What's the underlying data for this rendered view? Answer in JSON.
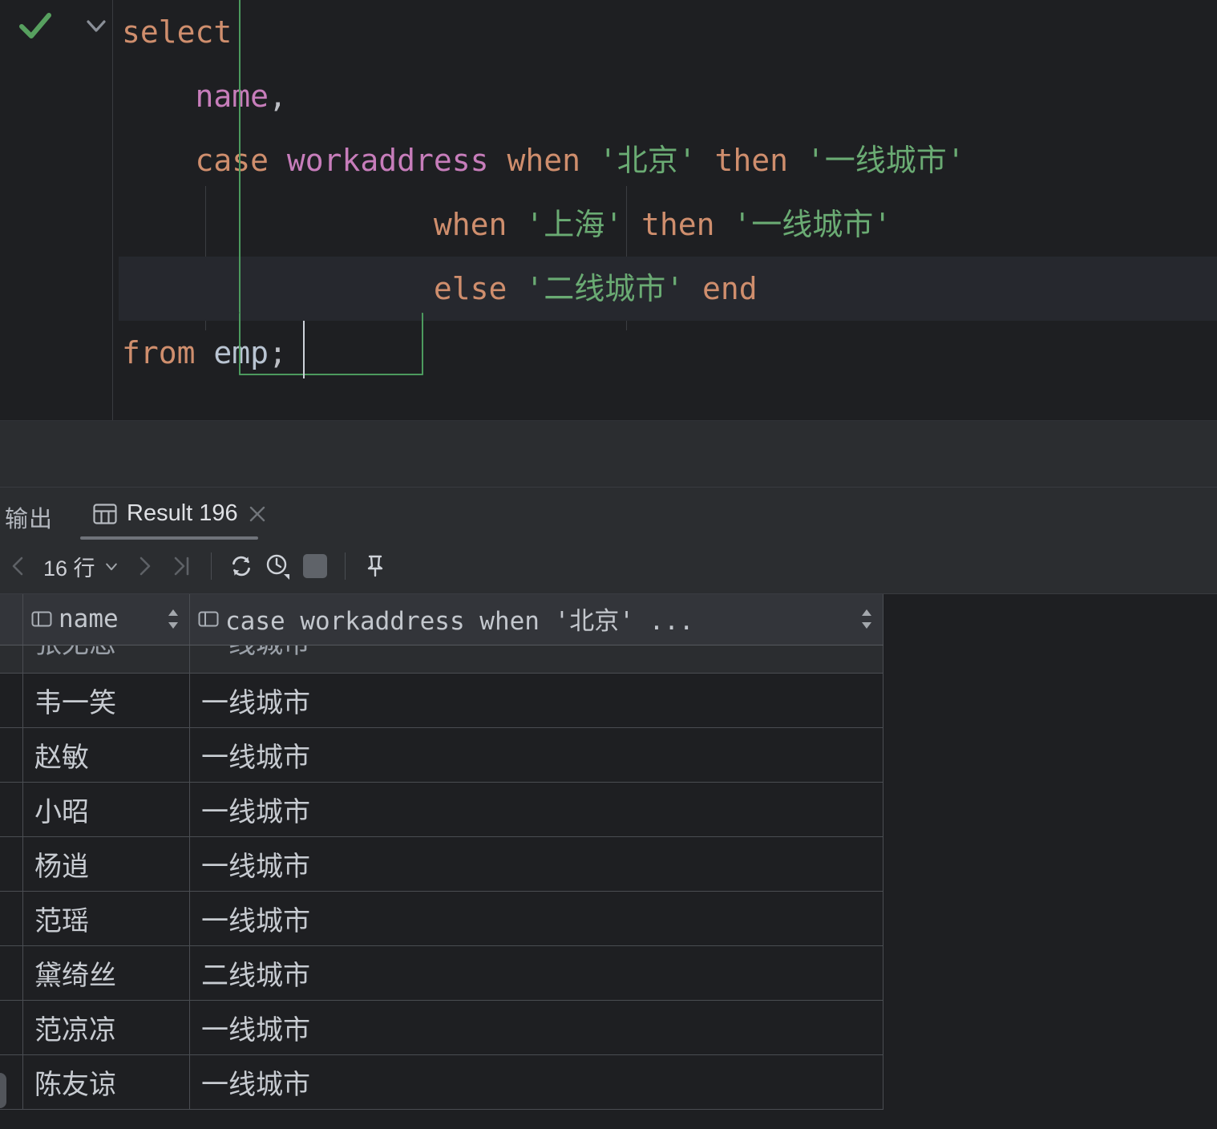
{
  "editor": {
    "status_icon": "green-check-ok",
    "fold_icon": "chevron-down",
    "lines": [
      {
        "id": "l1",
        "tokens": [
          {
            "t": "select",
            "c": "kw"
          }
        ]
      },
      {
        "id": "l2",
        "tokens": [
          {
            "t": "    name",
            "c": "col"
          },
          {
            "t": ",",
            "c": "plain"
          }
        ]
      },
      {
        "id": "l3",
        "tokens": [
          {
            "t": "    case ",
            "c": "kw"
          },
          {
            "t": "workaddress",
            "c": "col"
          },
          {
            "t": " when ",
            "c": "kw"
          },
          {
            "t": "'北京'",
            "c": "str"
          },
          {
            "t": " then ",
            "c": "kw"
          },
          {
            "t": "'一线城市'",
            "c": "str"
          }
        ]
      },
      {
        "id": "l4",
        "tokens": [
          {
            "t": "                 when ",
            "c": "kw"
          },
          {
            "t": "'上海'",
            "c": "str"
          },
          {
            "t": " then ",
            "c": "kw"
          },
          {
            "t": "'一线城市'",
            "c": "str"
          }
        ]
      },
      {
        "id": "l5",
        "tokens": [
          {
            "t": "                 else ",
            "c": "kw"
          },
          {
            "t": "'二线城市'",
            "c": "str"
          },
          {
            "t": " end",
            "c": "kw"
          }
        ]
      },
      {
        "id": "l6",
        "tokens": [
          {
            "t": "from ",
            "c": "kw"
          },
          {
            "t": "emp",
            "c": "tbl"
          },
          {
            "t": ";",
            "c": "plain"
          }
        ]
      }
    ],
    "current_line_index": 4,
    "selection_color": "#4c9a5e",
    "statement_text": "select\n    name,\n    case workaddress when '北京' then '一线城市'\n                 when '上海' then '一线城市'\n                 else '二线城市' end\nfrom emp;"
  },
  "panel": {
    "tabs": {
      "output_label": "输出",
      "result_label": "Result 196",
      "result_icon": "table-icon",
      "close_icon": "close-icon",
      "active": "Result 196"
    },
    "toolbar": {
      "prev_icon": "chevron-left",
      "rows_label": "16 行",
      "rows_dropdown_icon": "chevron-down",
      "next_icon": "chevron-right",
      "last_icon": "go-to-last",
      "refresh_icon": "refresh-icon",
      "history_icon": "clock-history-icon",
      "stop_icon": "stop-square-icon",
      "pin_icon": "pin-icon"
    }
  },
  "chart_data": {
    "type": "table",
    "title": "Result 196",
    "row_count_label": "16 行",
    "columns": [
      {
        "name": "name",
        "icon": "column-icon",
        "sort": "sortable"
      },
      {
        "name": "case workaddress when '北京' ...",
        "icon": "column-icon",
        "sort": "sortable"
      }
    ],
    "rows": [
      {
        "name": "张无忌",
        "category": "一线城市",
        "clipped": true
      },
      {
        "name": "韦一笑",
        "category": "一线城市"
      },
      {
        "name": "赵敏",
        "category": "一线城市"
      },
      {
        "name": "小昭",
        "category": "一线城市"
      },
      {
        "name": "杨逍",
        "category": "一线城市"
      },
      {
        "name": "范瑶",
        "category": "一线城市"
      },
      {
        "name": "黛绮丝",
        "category": "二线城市"
      },
      {
        "name": "范凉凉",
        "category": "一线城市"
      },
      {
        "name": "陈友谅",
        "category": "一线城市"
      }
    ]
  },
  "colors": {
    "editor_bg": "#1e1f22",
    "panel_bg": "#2b2d30",
    "keyword": "#cf8e6d",
    "identifier": "#c77dbb",
    "string": "#6aab73",
    "selection_border": "#4c9a5e",
    "grid_line": "#4a4d52",
    "header_bg": "#33353a"
  }
}
